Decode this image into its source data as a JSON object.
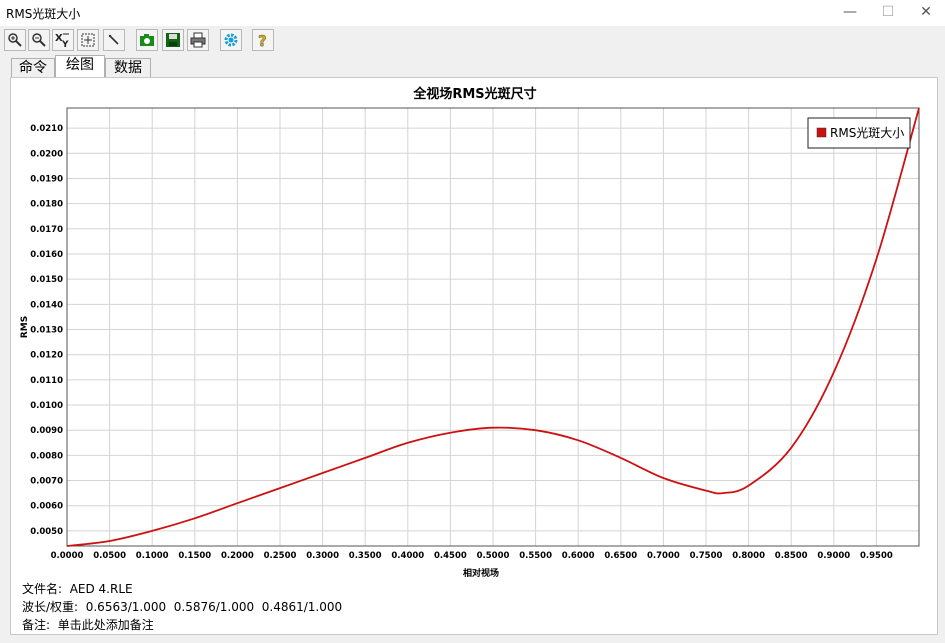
{
  "window": {
    "title": "RMS光斑大小",
    "minimize": "—",
    "maximize": "☐",
    "close": "✕"
  },
  "toolbar": {
    "buttons": [
      {
        "name": "zoom-in-icon"
      },
      {
        "name": "zoom-out-icon"
      },
      {
        "name": "xy-scale-icon"
      },
      {
        "name": "fit-view-icon"
      },
      {
        "name": "pen-icon"
      },
      {
        "name": "camera-icon"
      },
      {
        "name": "save-icon"
      },
      {
        "name": "print-icon"
      },
      {
        "name": "settings-gear-icon"
      },
      {
        "name": "help-icon"
      }
    ]
  },
  "tabs": [
    {
      "label": "命令",
      "active": false
    },
    {
      "label": "绘图",
      "active": true
    },
    {
      "label": "数据",
      "active": false
    }
  ],
  "chart_data": {
    "type": "line",
    "title": "全视场RMS光斑尺寸",
    "xlabel": "相对视场",
    "ylabel": "RMS",
    "xlim": [
      0,
      1.0
    ],
    "ylim": [
      0.0044,
      0.0218
    ],
    "x_ticks": [
      "0.0000",
      "0.0500",
      "0.1000",
      "0.1500",
      "0.2000",
      "0.2500",
      "0.3000",
      "0.3500",
      "0.4000",
      "0.4500",
      "0.5000",
      "0.5500",
      "0.6000",
      "0.6500",
      "0.7000",
      "0.7500",
      "0.8000",
      "0.8500",
      "0.9000",
      "0.9500"
    ],
    "y_ticks": [
      "0.0050",
      "0.0060",
      "0.0070",
      "0.0080",
      "0.0090",
      "0.0100",
      "0.0110",
      "0.0120",
      "0.0130",
      "0.0140",
      "0.0150",
      "0.0160",
      "0.0170",
      "0.0180",
      "0.0190",
      "0.0200",
      "0.0210"
    ],
    "grid": true,
    "legend_position": "top-right",
    "series": [
      {
        "name": "RMS光斑大小",
        "color": "#cc1111",
        "x": [
          0.0,
          0.05,
          0.1,
          0.15,
          0.2,
          0.25,
          0.3,
          0.35,
          0.4,
          0.45,
          0.5,
          0.55,
          0.6,
          0.65,
          0.7,
          0.75,
          0.77,
          0.8,
          0.85,
          0.9,
          0.95,
          1.0
        ],
        "y": [
          0.0044,
          0.0046,
          0.005,
          0.0055,
          0.0061,
          0.0067,
          0.0073,
          0.0079,
          0.0085,
          0.0089,
          0.0091,
          0.009,
          0.0086,
          0.0079,
          0.0071,
          0.0066,
          0.0065,
          0.0068,
          0.0083,
          0.0113,
          0.0158,
          0.0218
        ]
      }
    ]
  },
  "footer": {
    "file_label": "文件名:",
    "file_value": "AED 4.RLE",
    "wave_label": "波长/权重:",
    "wave_value": "0.6563/1.000  0.5876/1.000  0.4861/1.000",
    "note_label": "备注:",
    "note_value": "单击此处添加备注"
  }
}
